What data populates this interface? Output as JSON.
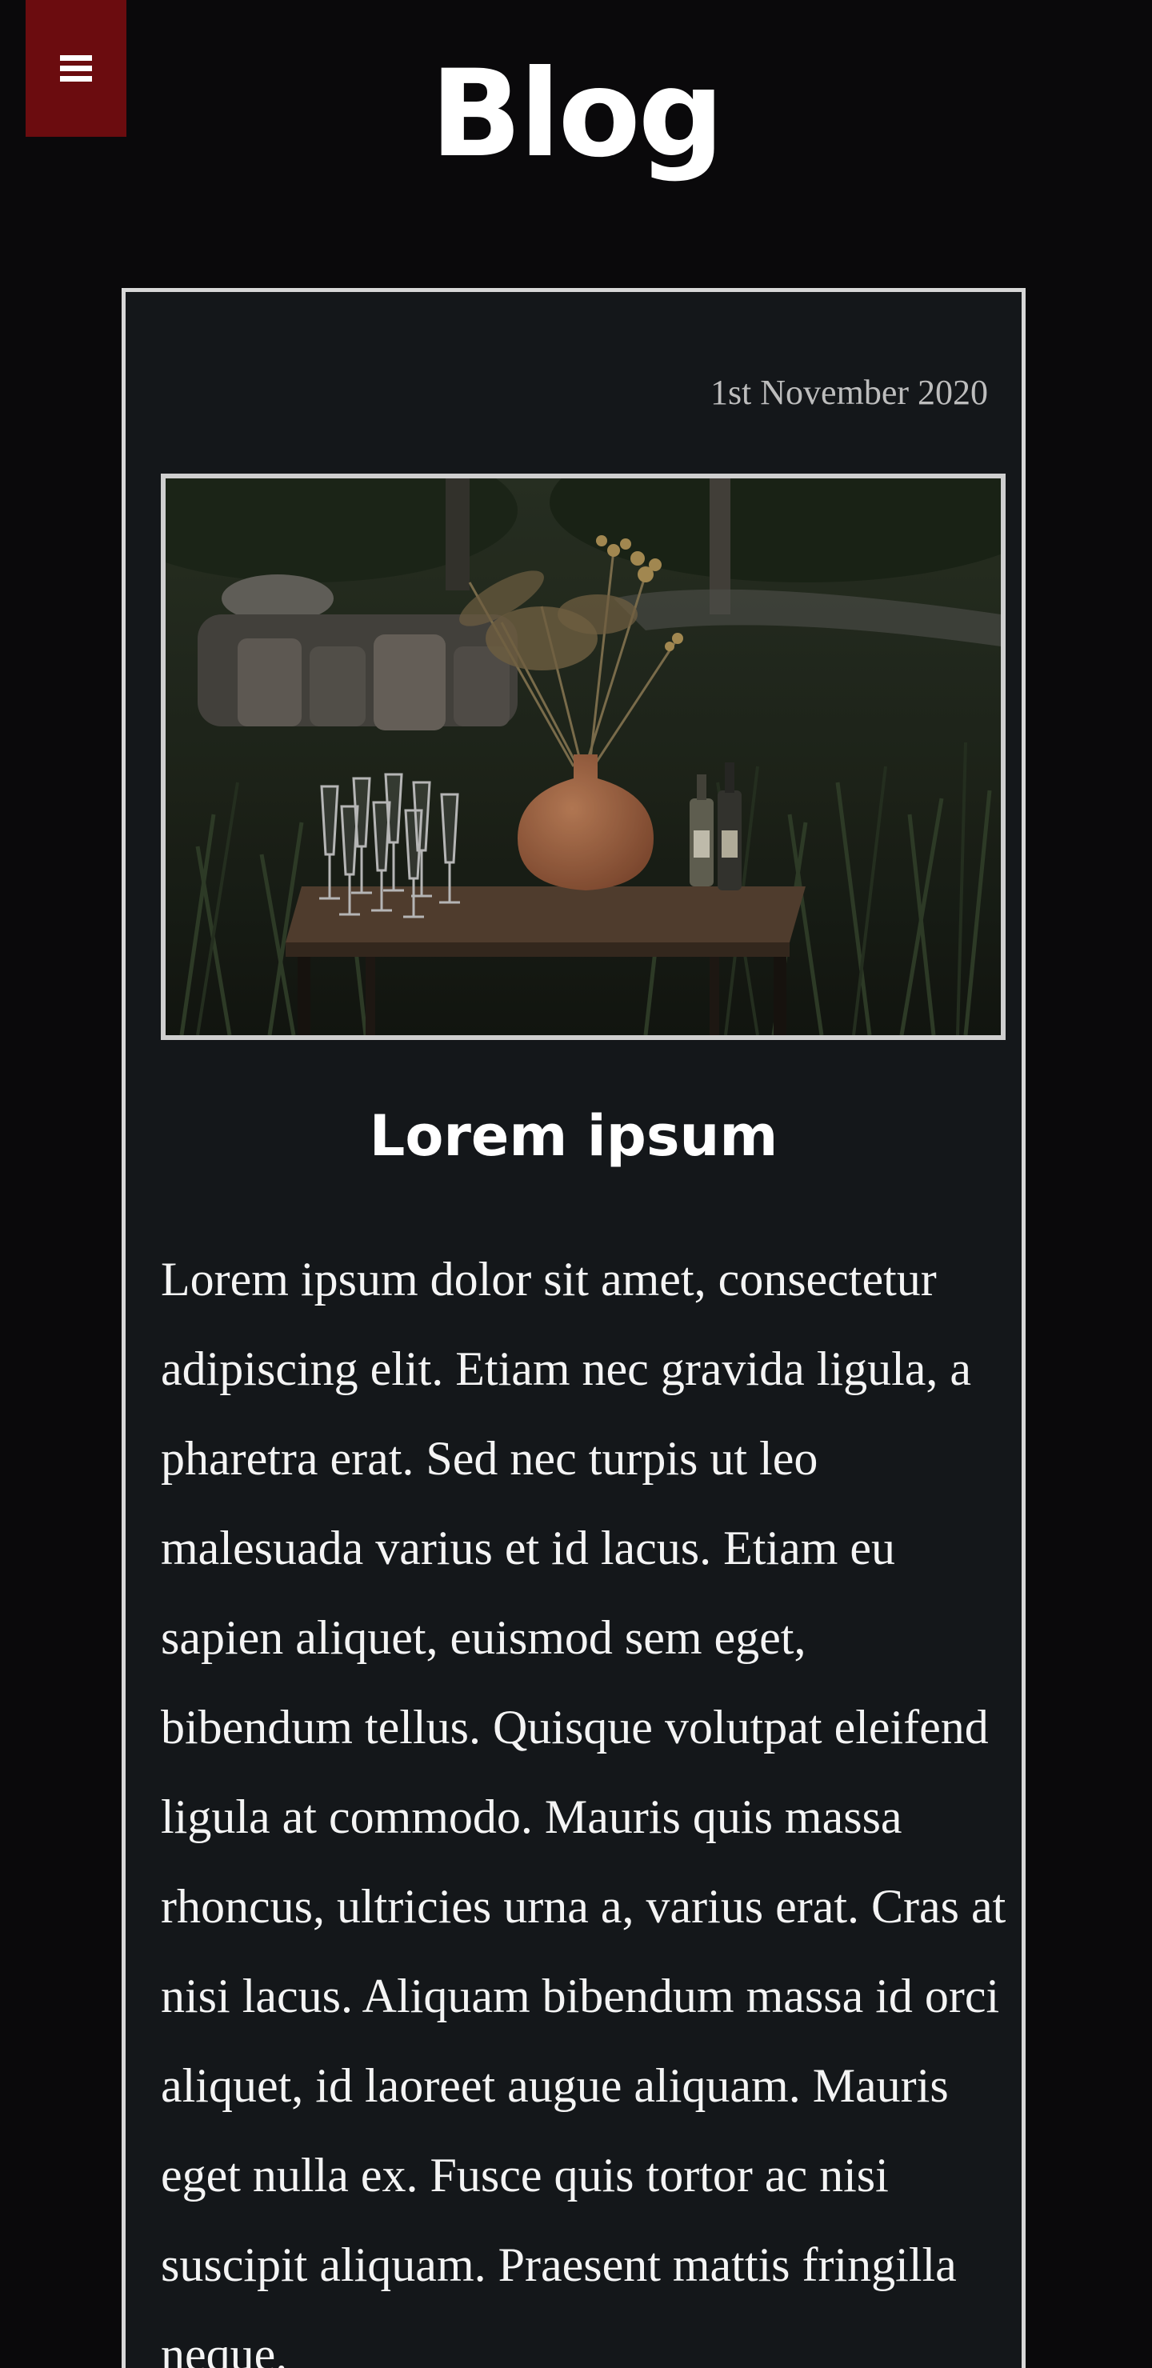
{
  "header": {
    "title": "Blog",
    "menu_icon": "hamburger-menu-icon"
  },
  "post": {
    "date": "1st November 2020",
    "image_description": "Wooden table outdoors with champagne glasses, a terracotta vase of dried flowers and bottles",
    "title": "Lorem ipsum",
    "body": "Lorem ipsum dolor sit amet, consectetur adipiscing elit. Etiam nec gravida ligula, a pharetra erat. Sed nec turpis ut leo malesuada varius et id lacus. Etiam eu sapien aliquet, euismod sem eget, bibendum tellus. Quisque volutpat eleifend ligula at commodo. Mauris quis massa rhoncus, ultricies urna a, varius erat. Cras at nisi lacus. Aliquam bibendum massa id orci aliquet, id laoreet augue aliquam. Mauris eget nulla ex. Fusce quis tortor ac nisi suscipit aliquam. Praesent mattis fringilla neque."
  },
  "colors": {
    "background": "#0a090b",
    "menu_button": "#6b0c0f",
    "card_background": "#14171a",
    "card_border": "#d7d7d7"
  }
}
